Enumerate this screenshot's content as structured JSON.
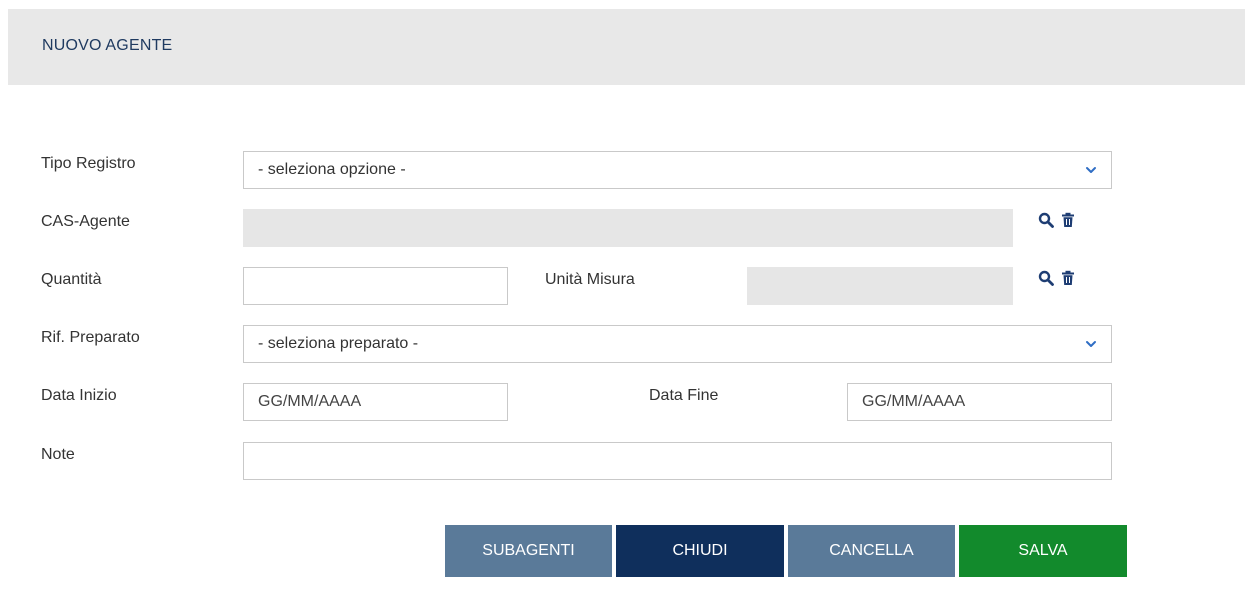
{
  "header": {
    "title": "NUOVO AGENTE"
  },
  "form": {
    "tipo_registro": {
      "label": "Tipo Registro",
      "value": "- seleziona opzione -"
    },
    "cas_agente": {
      "label": "CAS-Agente",
      "value": ""
    },
    "quantita": {
      "label": "Quantità",
      "value": ""
    },
    "unita_misura": {
      "label": "Unità Misura",
      "value": ""
    },
    "rif_preparato": {
      "label": "Rif. Preparato",
      "value": "- seleziona preparato -"
    },
    "data_inizio": {
      "label": "Data Inizio",
      "placeholder": "GG/MM/AAAA"
    },
    "data_fine": {
      "label": "Data Fine",
      "placeholder": "GG/MM/AAAA"
    },
    "note": {
      "label": "Note",
      "value": ""
    }
  },
  "icons": {
    "search": "search-icon",
    "delete": "trash-icon",
    "dropdown": "chevron-down-icon"
  },
  "buttons": {
    "subagenti": "SUBAGENTI",
    "chiudi": "CHIUDI",
    "cancella": "CANCELLA",
    "salva": "SALVA"
  },
  "colors": {
    "header_bg": "#e8e8e8",
    "title": "#1f3a60",
    "btn_secondary": "#5a7a99",
    "btn_primary": "#0f2f5c",
    "btn_success": "#128a2c",
    "readonly_bg": "#e6e6e6",
    "icon": "#1e3d73"
  }
}
